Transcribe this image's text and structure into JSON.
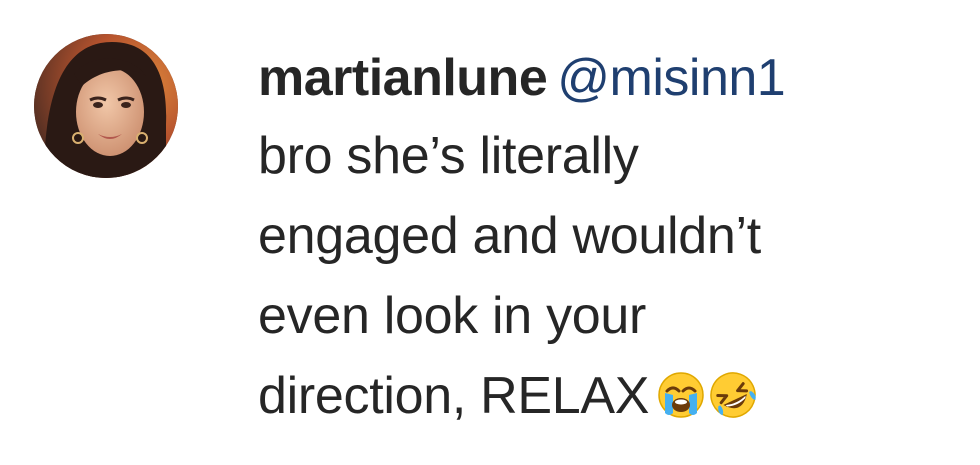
{
  "comment": {
    "username": "martianlune",
    "mention": "@misinn1",
    "text_lines": [
      "bro she’s literally",
      "engaged and wouldn’t",
      "even look in your",
      "direction, RELAX"
    ],
    "emojis": [
      "crying-face-icon",
      "rofl-face-icon"
    ],
    "colors": {
      "text": "#262626",
      "mention": "#1f3f70"
    }
  }
}
